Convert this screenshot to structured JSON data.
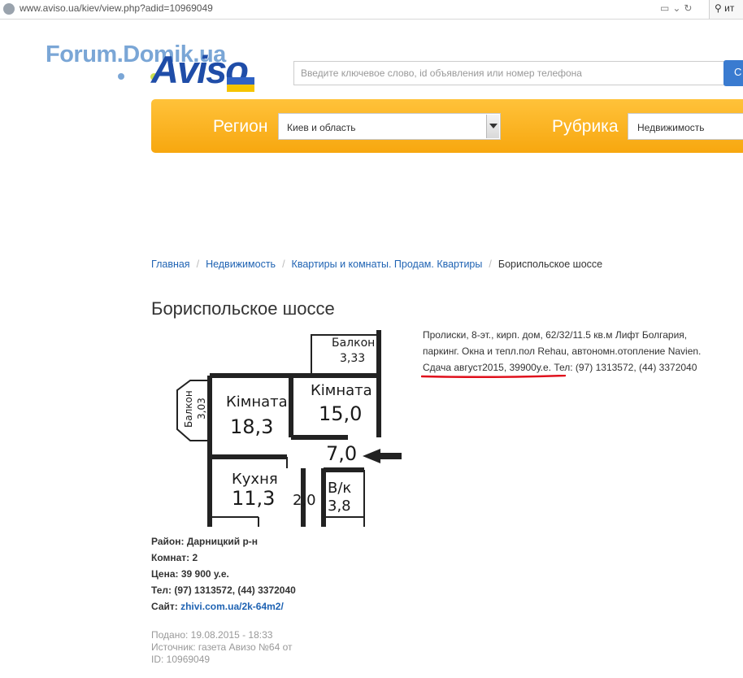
{
  "browser": {
    "url": "www.aviso.ua/kiev/view.php?adid=10969049",
    "search_value": "ит"
  },
  "logo": {
    "forum_text": "Forum.Domik.ua",
    "aviso_text": "Aviso"
  },
  "search": {
    "placeholder": "Введите ключевое слово, id объявления или номер телефона",
    "button_label": "С"
  },
  "filters": {
    "region_label": "Регион",
    "region_value": "Киев и область",
    "rubric_label": "Рубрика",
    "rubric_value": "Недвижимость"
  },
  "breadcrumb": {
    "items": [
      "Главная",
      "Недвижимость",
      "Квартиры и комнаты. Продам. Квартиры"
    ],
    "current": "Бориспольское шоссе"
  },
  "listing": {
    "title": "Бориспольское шоссе",
    "description_lines": [
      "Пролиски, 8-эт., кирп. дом, 62/32/11.5 кв.м Лифт Болгария,",
      "паркинг. Окна и тепл.пол Rehau, автономн.отопление Navien.",
      "Сдача август2015, 39900у.е. Тел: (97) 1313572, (44) 3372040"
    ],
    "floorplan": {
      "balcony_top_label": "Балкон",
      "balcony_top_area": "3,33",
      "balcony_left_label": "Балкон",
      "balcony_left_area": "3,03",
      "room1_label": "Кімната",
      "room1_area": "18,3",
      "room2_label": "Кімната",
      "room2_area": "15,0",
      "hall_area": "7,0",
      "kitchen_label": "Кухня",
      "kitchen_area": "11,3",
      "bath_area": "2,0",
      "wc_label": "В/к",
      "wc_area": "3,8"
    },
    "details": {
      "district_label": "Район:",
      "district_value": "Дарницкий р-н",
      "rooms_label": "Комнат:",
      "rooms_value": "2",
      "price_label": "Цена:",
      "price_value": "39 900 у.е.",
      "phone_label": "Тел:",
      "phone_value": "(97) 1313572, (44) 3372040",
      "site_label": "Сайт:",
      "site_value": "zhivi.com.ua/2k-64m2/"
    },
    "meta": {
      "posted": "Подано: 19.08.2015 - 18:33",
      "source": "Источник: газета Авизо №64 от",
      "id": "ID: 10969049"
    }
  },
  "colors": {
    "link": "#1f63b3",
    "orange": "#f7a70f",
    "underline": "#e0101c"
  }
}
